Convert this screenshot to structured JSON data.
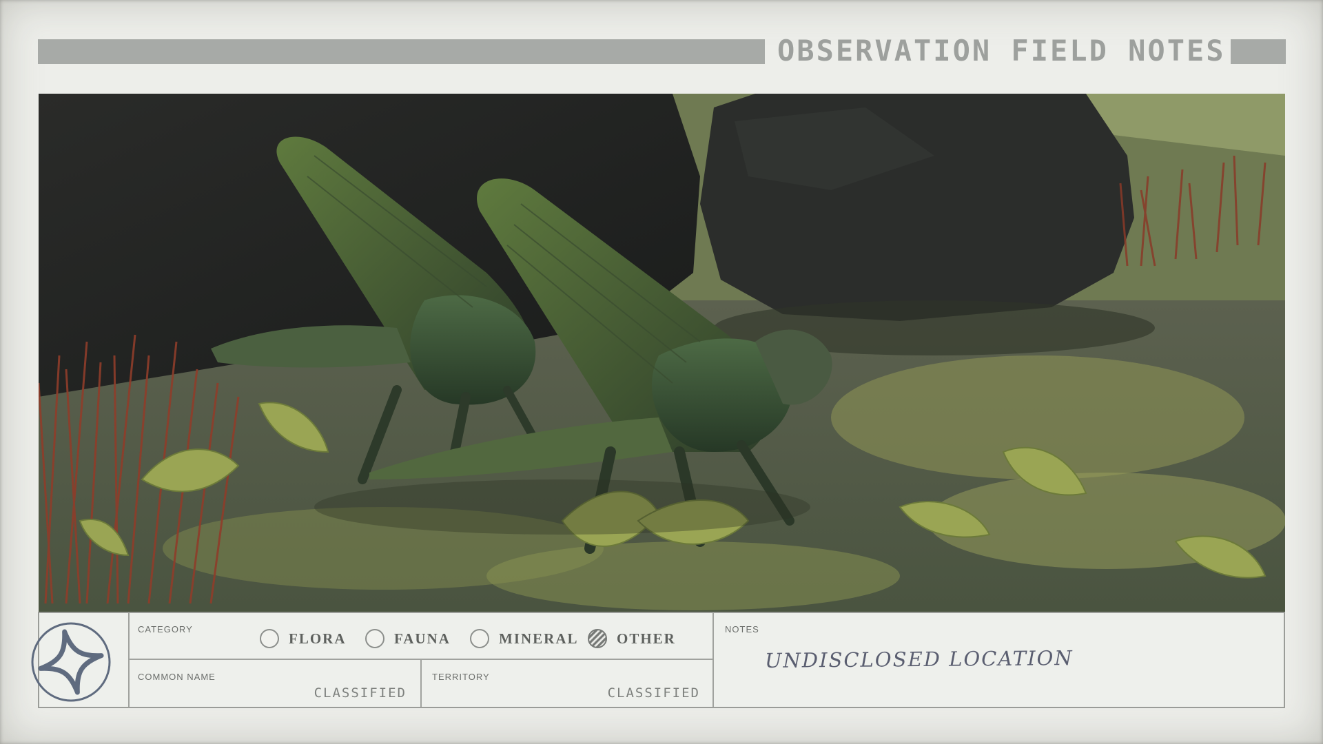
{
  "header": {
    "title": "OBSERVATION FIELD NOTES"
  },
  "photo": {
    "subject": "creature-photo"
  },
  "panel": {
    "category_label": "CATEGORY",
    "categories": [
      {
        "label": "FLORA",
        "selected": false
      },
      {
        "label": "FAUNA",
        "selected": false
      },
      {
        "label": "MINERAL",
        "selected": false
      },
      {
        "label": "OTHER",
        "selected": true
      }
    ],
    "common_name_label": "COMMON NAME",
    "common_name_value": "CLASSIFIED",
    "territory_label": "TERRITORY",
    "territory_value": "CLASSIFIED",
    "notes_label": "NOTES",
    "notes_value": "UNDISCLOSED LOCATION"
  },
  "colors": {
    "paper": "#edeeea",
    "bar": "#a7aaa7",
    "ink": "#5a5e70"
  },
  "icons": {
    "logo": "constellation-star-icon"
  }
}
